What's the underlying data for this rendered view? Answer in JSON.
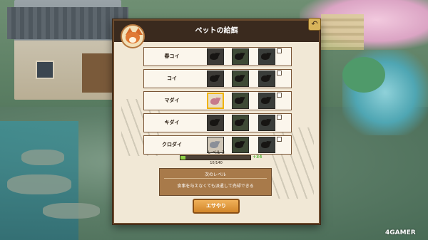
{
  "panel": {
    "title": "ペットの給餌",
    "back_icon": "back-arrow-icon",
    "fish_rows": [
      {
        "name": "春コイ",
        "slots": [
          "locked",
          "locked",
          "locked"
        ]
      },
      {
        "name": "コイ",
        "slots": [
          "locked",
          "locked",
          "locked"
        ]
      },
      {
        "name": "マダイ",
        "slots": [
          "selected",
          "locked",
          "locked"
        ]
      },
      {
        "name": "キダイ",
        "slots": [
          "locked",
          "locked",
          "locked"
        ]
      },
      {
        "name": "クロダイ",
        "slots": [
          "unlocked",
          "locked",
          "locked"
        ]
      }
    ],
    "level": {
      "label": "レベル 3",
      "bonus": "+34",
      "count": "10/140",
      "progress_fraction": 0.07
    },
    "next_level": {
      "heading": "次のレベル",
      "description": "食事を与えなくても派遣して売却できる"
    },
    "feed_button": "エサやり"
  },
  "watermark": "4GAMER",
  "colors": {
    "accent": "#f0b400",
    "progress": "#8ed147",
    "button": "#d2862a"
  }
}
